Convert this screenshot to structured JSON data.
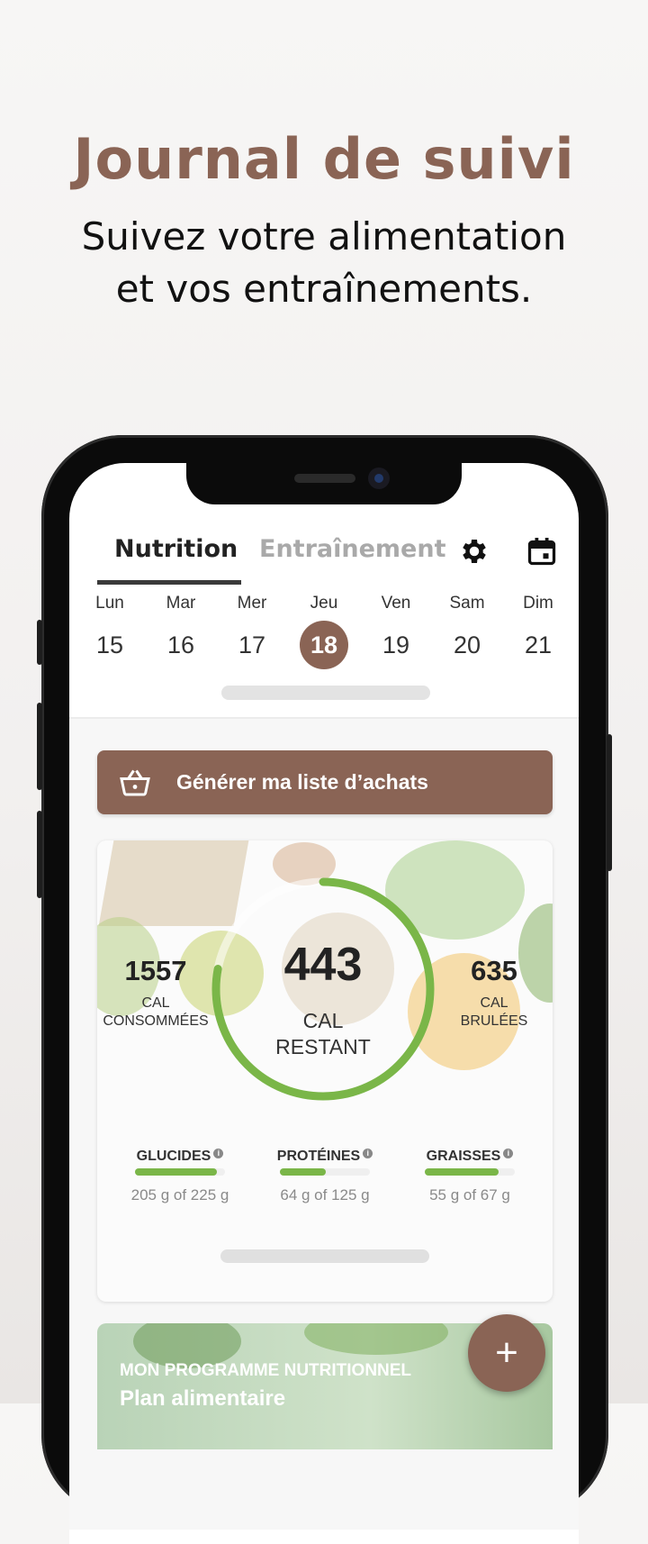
{
  "promo": {
    "title": "Journal de suivi",
    "subtitle_line1": "Suivez votre alimentation",
    "subtitle_line2": "et vos entraînements."
  },
  "tabs": {
    "nutrition": "Nutrition",
    "training": "Entraînement",
    "settings_icon": "gear-icon",
    "calendar_icon": "calendar-icon"
  },
  "week": [
    {
      "label": "Lun",
      "num": "15"
    },
    {
      "label": "Mar",
      "num": "16"
    },
    {
      "label": "Mer",
      "num": "17"
    },
    {
      "label": "Jeu",
      "num": "18",
      "selected": true
    },
    {
      "label": "Ven",
      "num": "19"
    },
    {
      "label": "Sam",
      "num": "20"
    },
    {
      "label": "Dim",
      "num": "21"
    }
  ],
  "shopping": {
    "label": "Générer ma liste d’achats",
    "icon": "basket-icon"
  },
  "summary": {
    "consumed_value": "1557",
    "consumed_label1": "CAL",
    "consumed_label2": "CONSOMMÉES",
    "remaining_value": "443",
    "remaining_label1": "CAL",
    "remaining_label2": "RESTANT",
    "burned_value": "635",
    "burned_label1": "CAL",
    "burned_label2": "BRULÉES",
    "ring_progress": 0.78
  },
  "macros": [
    {
      "name": "GLUCIDES",
      "value": "205 g of 225 g",
      "progress": 0.91
    },
    {
      "name": "PROTÉINES",
      "value": "64 g of 125 g",
      "progress": 0.51
    },
    {
      "name": "GRAISSES",
      "value": "55 g of 67 g",
      "progress": 0.82
    }
  ],
  "program": {
    "label": "MON PROGRAMME NUTRITIONNEL",
    "title": "Plan alimentaire"
  },
  "fab": {
    "label": "+"
  },
  "colors": {
    "accent": "#8a6455",
    "progress": "#7ab648"
  }
}
